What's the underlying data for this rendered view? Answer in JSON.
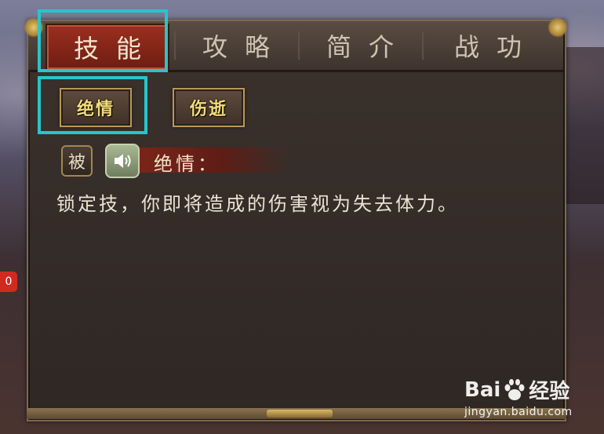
{
  "tabs": [
    {
      "label": "技能",
      "active": true
    },
    {
      "label": "攻略",
      "active": false
    },
    {
      "label": "简介",
      "active": false
    },
    {
      "label": "战功",
      "active": false
    }
  ],
  "skills": [
    {
      "label": "绝情",
      "selected": true
    },
    {
      "label": "伤逝",
      "selected": false
    }
  ],
  "skill_detail": {
    "type_badge": "被",
    "name": "绝情：",
    "description": "锁定技，你即将造成的伤害视为失去体力。"
  },
  "side_badge": "0",
  "watermark": {
    "brand_left": "Bai",
    "brand_right": "经验",
    "url": "jingyan.baidu.com"
  },
  "colors": {
    "highlight": "#26c6cc",
    "active_tab": "#9b2f1f",
    "skill_text": "#f5dc7a"
  }
}
